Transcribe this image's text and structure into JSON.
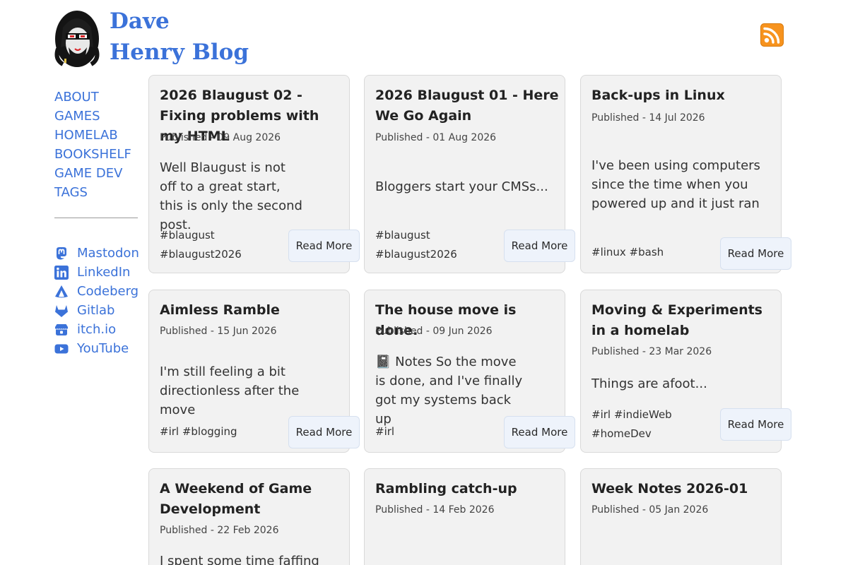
{
  "site": {
    "title": "Dave Henry Blog"
  },
  "nav": {
    "items": [
      {
        "label": "ABOUT"
      },
      {
        "label": "GAMES"
      },
      {
        "label": "HOMELAB"
      },
      {
        "label": "BOOKSHELF"
      },
      {
        "label": "GAME DEV"
      },
      {
        "label": "TAGS"
      }
    ]
  },
  "social": {
    "items": [
      {
        "label": "Mastodon",
        "icon": "mastodon-icon"
      },
      {
        "label": "LinkedIn",
        "icon": "linkedin-icon"
      },
      {
        "label": "Codeberg",
        "icon": "codeberg-icon"
      },
      {
        "label": "Gitlab",
        "icon": "gitlab-icon"
      },
      {
        "label": "itch.io",
        "icon": "itchio-icon"
      },
      {
        "label": "YouTube",
        "icon": "youtube-icon"
      }
    ]
  },
  "posts": [
    {
      "title": "2026 Blaugust 02 - Fixing problems with my HTML",
      "date": "Published - 09 Aug 2026",
      "excerpt": "Well Blaugust is not off to a great start, this is only the second post.",
      "tags": "#blaugust #blaugust2026",
      "read_more": "Read More"
    },
    {
      "title": "2026 Blaugust 01 - Here We Go Again",
      "date": "Published - 01 Aug 2026",
      "excerpt": "Bloggers start your CMSs...",
      "tags": "#blaugust #blaugust2026",
      "read_more": "Read More"
    },
    {
      "title": "Back-ups in Linux",
      "date": "Published - 14 Jul 2026",
      "excerpt": "I've been using computers since the time when you powered up and it just ran",
      "tags": "#linux #bash",
      "read_more": "Read More"
    },
    {
      "title": "Aimless Ramble",
      "date": "Published - 15 Jun 2026",
      "excerpt": "I'm still feeling a bit directionless after the move",
      "tags": "#irl #blogging",
      "read_more": "Read More"
    },
    {
      "title": "The house move is done.",
      "date": "Published - 09 Jun 2026",
      "excerpt": "📓 Notes So the move is done, and I've finally got my systems back up",
      "tags": "#irl",
      "read_more": "Read More"
    },
    {
      "title": "Moving & Experiments in a homelab",
      "date": "Published - 23 Mar 2026",
      "excerpt": "Things are afoot...",
      "tags": "#irl #indieWeb #homeDev",
      "read_more": "Read More"
    },
    {
      "title": "A Weekend of Game Development",
      "date": "Published - 22 Feb 2026",
      "excerpt": "I spent some time faffing",
      "tags": "",
      "read_more": ""
    },
    {
      "title": "Rambling catch-up",
      "date": "Published - 14 Feb 2026",
      "excerpt": "",
      "tags": "",
      "read_more": ""
    },
    {
      "title": "Week Notes 2026-01",
      "date": "Published - 05 Jan 2026",
      "excerpt": "",
      "tags": "",
      "read_more": ""
    }
  ],
  "colors": {
    "link": "#3b72d9",
    "card_bg": "#f2f2f2",
    "button_bg": "#eef3fb",
    "rss": "#f7931e"
  }
}
